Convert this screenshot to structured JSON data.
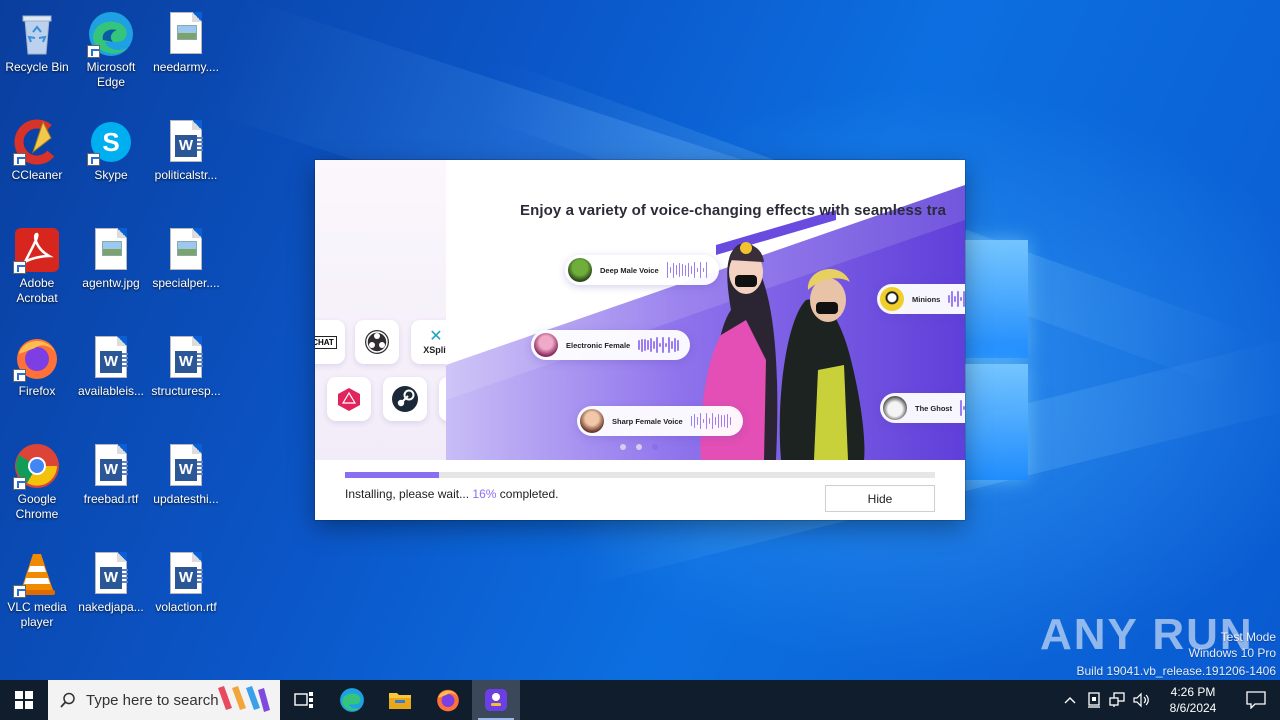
{
  "desktop": {
    "icons": [
      {
        "label": "Recycle Bin",
        "icon": "recycle-bin-icon"
      },
      {
        "label": "Microsoft Edge",
        "icon": "edge-icon"
      },
      {
        "label": "needarmy....",
        "icon": "image-file-icon"
      },
      {
        "label": "CCleaner",
        "icon": "ccleaner-icon"
      },
      {
        "label": "Skype",
        "icon": "skype-icon"
      },
      {
        "label": "politicalstr...",
        "icon": "word-document-icon"
      },
      {
        "label": "Adobe Acrobat",
        "icon": "acrobat-icon"
      },
      {
        "label": "agentw.jpg",
        "icon": "image-file-icon"
      },
      {
        "label": "specialper....",
        "icon": "image-file-icon"
      },
      {
        "label": "Firefox",
        "icon": "firefox-icon"
      },
      {
        "label": "availableis...",
        "icon": "word-document-icon"
      },
      {
        "label": "structuresp...",
        "icon": "word-document-icon"
      },
      {
        "label": "Google Chrome",
        "icon": "chrome-icon"
      },
      {
        "label": "freebad.rtf",
        "icon": "word-document-icon"
      },
      {
        "label": "updatesthi...",
        "icon": "word-document-icon"
      },
      {
        "label": "VLC media player",
        "icon": "vlc-icon"
      },
      {
        "label": "nakedjapa...",
        "icon": "word-document-icon"
      },
      {
        "label": "volaction.rtf",
        "icon": "word-document-icon"
      }
    ]
  },
  "installer": {
    "banner_title": "Enjoy a variety of voice-changing effects with seamless tra",
    "voices": [
      {
        "name": "Deep Male Voice"
      },
      {
        "name": "Minions"
      },
      {
        "name": "Electronic Female"
      },
      {
        "name": "The Ghost"
      },
      {
        "name": "Sharp Female Voice"
      }
    ],
    "app_tiles": {
      "chat": "CHAT",
      "xsplit": "XSplit"
    },
    "progress": 0.16,
    "status_prefix": "Installing, please wait... ",
    "status_percent": "16%",
    "status_suffix": " completed.",
    "hide_label": "Hide"
  },
  "watermark": {
    "logo": "ANY RUN",
    "mode": "Test Mode",
    "os": "Windows 10 Pro",
    "build": "Build 19041.vb_release.191206-1406"
  },
  "taskbar": {
    "search_placeholder": "Type here to search",
    "time": "4:26 PM",
    "date": "8/6/2024"
  },
  "colors": {
    "accent_purple": "#8a6ff0",
    "taskbar": "#101d2d",
    "desktop_blue": "#0b56c8"
  }
}
